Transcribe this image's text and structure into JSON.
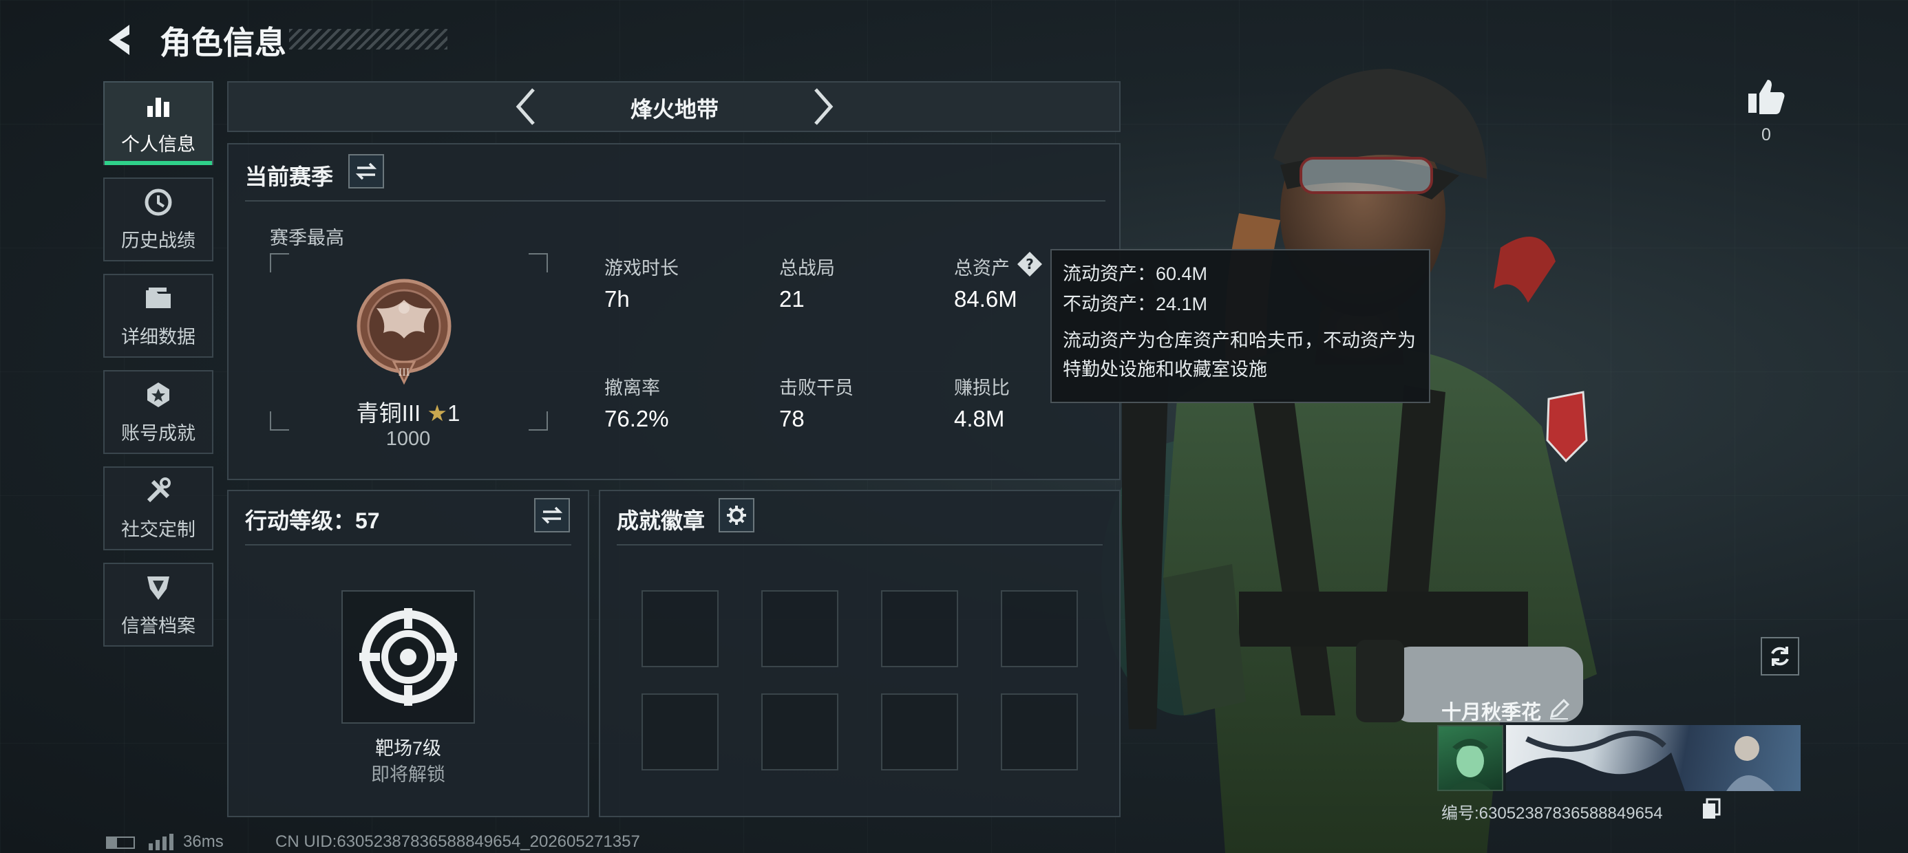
{
  "header": {
    "title": "角色信息"
  },
  "sidebar": {
    "items": [
      {
        "label": "个人信息",
        "icon": "bar-chart-icon",
        "active": true
      },
      {
        "label": "历史战绩",
        "icon": "history-clock-icon",
        "active": false
      },
      {
        "label": "详细数据",
        "icon": "folder-icon",
        "active": false
      },
      {
        "label": "账号成就",
        "icon": "achievement-icon",
        "active": false
      },
      {
        "label": "社交定制",
        "icon": "tools-icon",
        "active": false
      },
      {
        "label": "信誉档案",
        "icon": "credit-badge-icon",
        "active": false
      }
    ]
  },
  "mode_selector": {
    "label": "烽火地带"
  },
  "season": {
    "title": "当前赛季",
    "best_label": "赛季最高",
    "rank_name": "青铜III",
    "rank_stars": "1",
    "rank_score": "1000",
    "stats": [
      {
        "label": "游戏时长",
        "value": "7h"
      },
      {
        "label": "总战局",
        "value": "21"
      },
      {
        "label": "总资产",
        "value": "84.6M"
      },
      {
        "label": "撤离率",
        "value": "76.2%"
      },
      {
        "label": "击败干员",
        "value": "78"
      },
      {
        "label": "赚损比",
        "value": "4.8M"
      }
    ]
  },
  "tooltip": {
    "liquid": "流动资产：60.4M",
    "fixed": "不动资产：24.1M",
    "desc": "流动资产为仓库资产和哈夫币，不动资产为特勤处设施和收藏室设施"
  },
  "action_level": {
    "title": "行动等级：57",
    "unlock_name": "靶场7级",
    "unlock_status": "即将解锁"
  },
  "badges": {
    "title": "成就徽章"
  },
  "likes": {
    "count": "0"
  },
  "profile": {
    "name": "十月秋季花",
    "id_text": "编号:63052387836588849654"
  },
  "status_bar": {
    "ping": "36ms",
    "uid": "CN UID:63052387836588849654_202605271357"
  },
  "colors": {
    "accent": "#2fd18a",
    "panel": "#1e262c",
    "border": "#3a464d"
  }
}
